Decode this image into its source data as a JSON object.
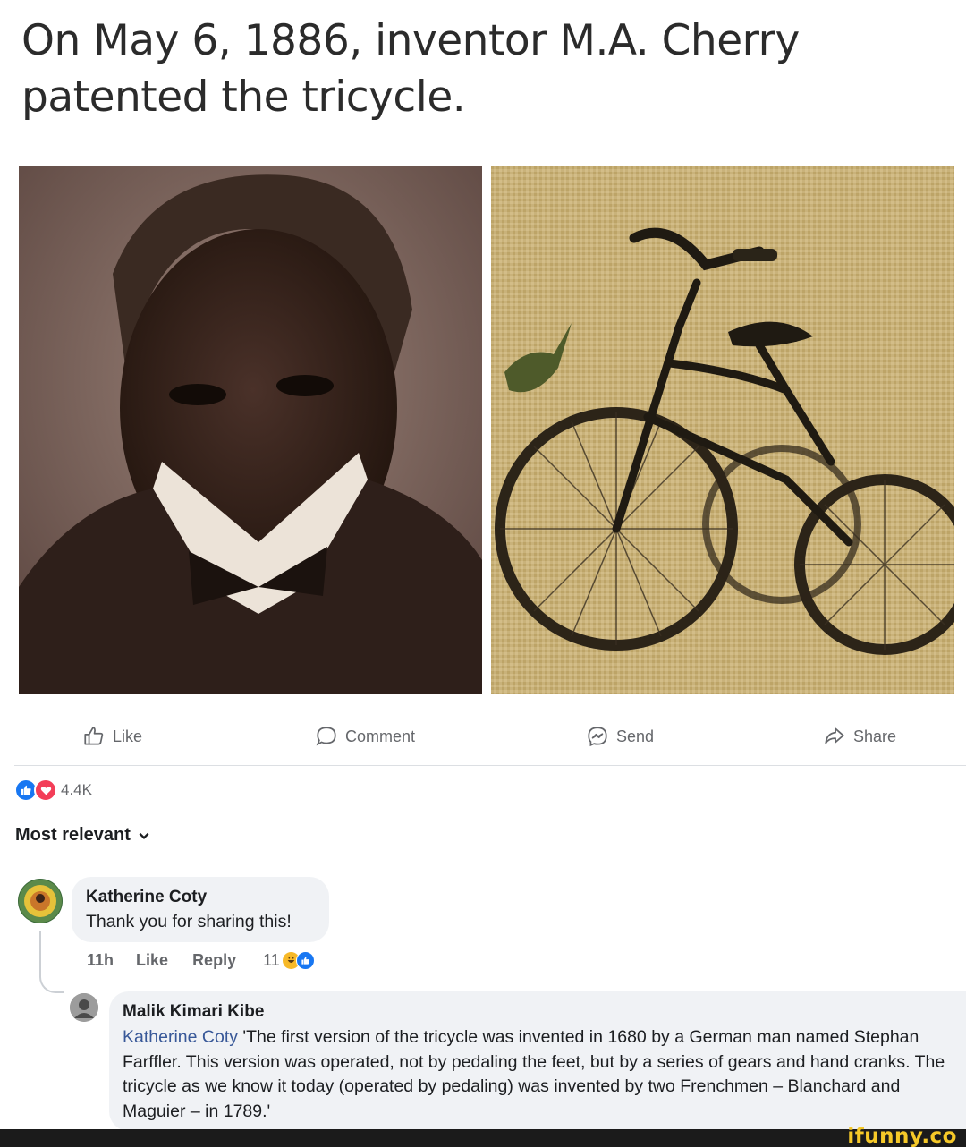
{
  "post": {
    "headline": "On May 6, 1886, inventor M.A. Cherry patented the tricycle."
  },
  "actions": {
    "like": "Like",
    "comment": "Comment",
    "send": "Send",
    "share": "Share"
  },
  "reactions": {
    "count": "4.4K"
  },
  "sort": {
    "label": "Most relevant"
  },
  "comments": [
    {
      "author": "Katherine Coty",
      "text": "Thank you for sharing this!",
      "time": "11h",
      "like": "Like",
      "reply": "Reply",
      "reaction_count": "11"
    }
  ],
  "reply": {
    "author": "Malik Kimari Kibe",
    "mention": "Katherine Coty",
    "text": " 'The first version of the tricycle was invented in 1680 by a German man named Stephan Farffler. This version was operated, not by pedaling the feet, but by a series of gears and hand cranks. The tricycle as we know it today (operated by pedaling) was invented by two Frenchmen – Blanchard and Maguier – in 1789.'"
  },
  "watermark": "ifunny.co",
  "colors": {
    "like_blue": "#1877f2",
    "love_red": "#f33e58",
    "mention": "#385898",
    "haha_yellow": "#f7b928"
  }
}
